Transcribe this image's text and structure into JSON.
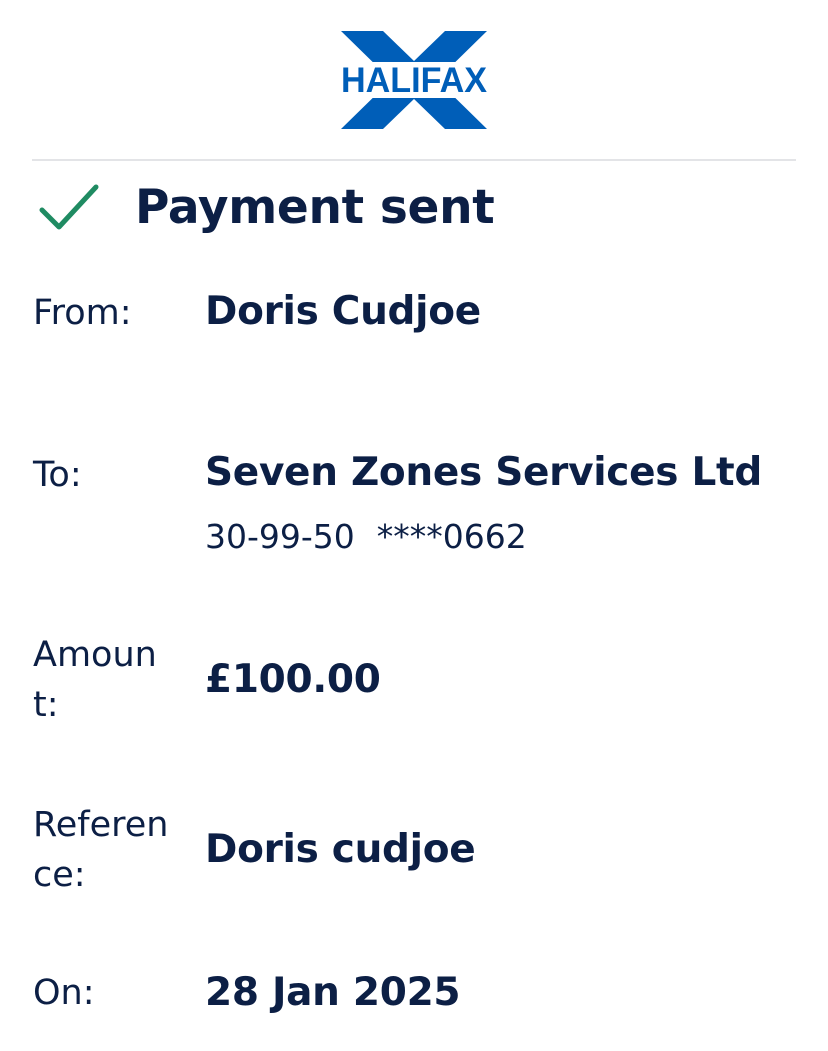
{
  "brand": {
    "name": "HALIFAX",
    "color": "#005eb8"
  },
  "status": {
    "title": "Payment sent",
    "icon": "checkmark-icon",
    "check_color": "#1f8b62"
  },
  "details": {
    "from": {
      "label": "From:",
      "value": "Doris Cudjoe"
    },
    "to": {
      "label": "To:",
      "value": "Seven Zones Services Ltd",
      "sort_code": "30-99-50",
      "account": "****0662"
    },
    "amount": {
      "label": "Amount:",
      "value": "£100.00"
    },
    "reference": {
      "label": "Reference:",
      "value": "Doris cudjoe"
    },
    "on": {
      "label": "On:",
      "value": "28 Jan 2025"
    }
  },
  "colors": {
    "text": "#0c1f45",
    "divider": "#e3e4e7"
  }
}
